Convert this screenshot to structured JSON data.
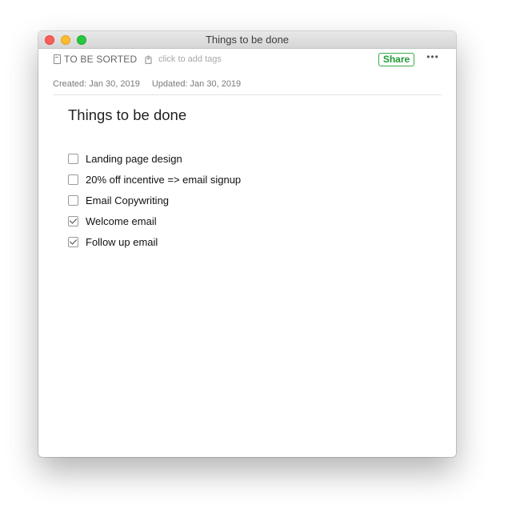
{
  "window": {
    "title": "Things to be done"
  },
  "meta": {
    "notebook": "TO BE SORTED",
    "tags_placeholder": "click to add tags",
    "share_label": "Share",
    "more_label": "•••",
    "created": "Created: Jan 30, 2019",
    "updated": "Updated: Jan 30, 2019"
  },
  "note": {
    "title": "Things to be done",
    "items": [
      {
        "label": "Landing page design",
        "checked": false
      },
      {
        "label": "20% off incentive => email signup",
        "checked": false
      },
      {
        "label": "Email Copywriting",
        "checked": false
      },
      {
        "label": "Welcome email",
        "checked": true
      },
      {
        "label": "Follow up email",
        "checked": true
      }
    ]
  },
  "colors": {
    "accent": "#1f9a34",
    "close": "#fc5f57",
    "minimize": "#fdbc2e",
    "maximize": "#29c840"
  },
  "icons": [
    "notebook-icon",
    "tag-icon",
    "more-icon"
  ]
}
